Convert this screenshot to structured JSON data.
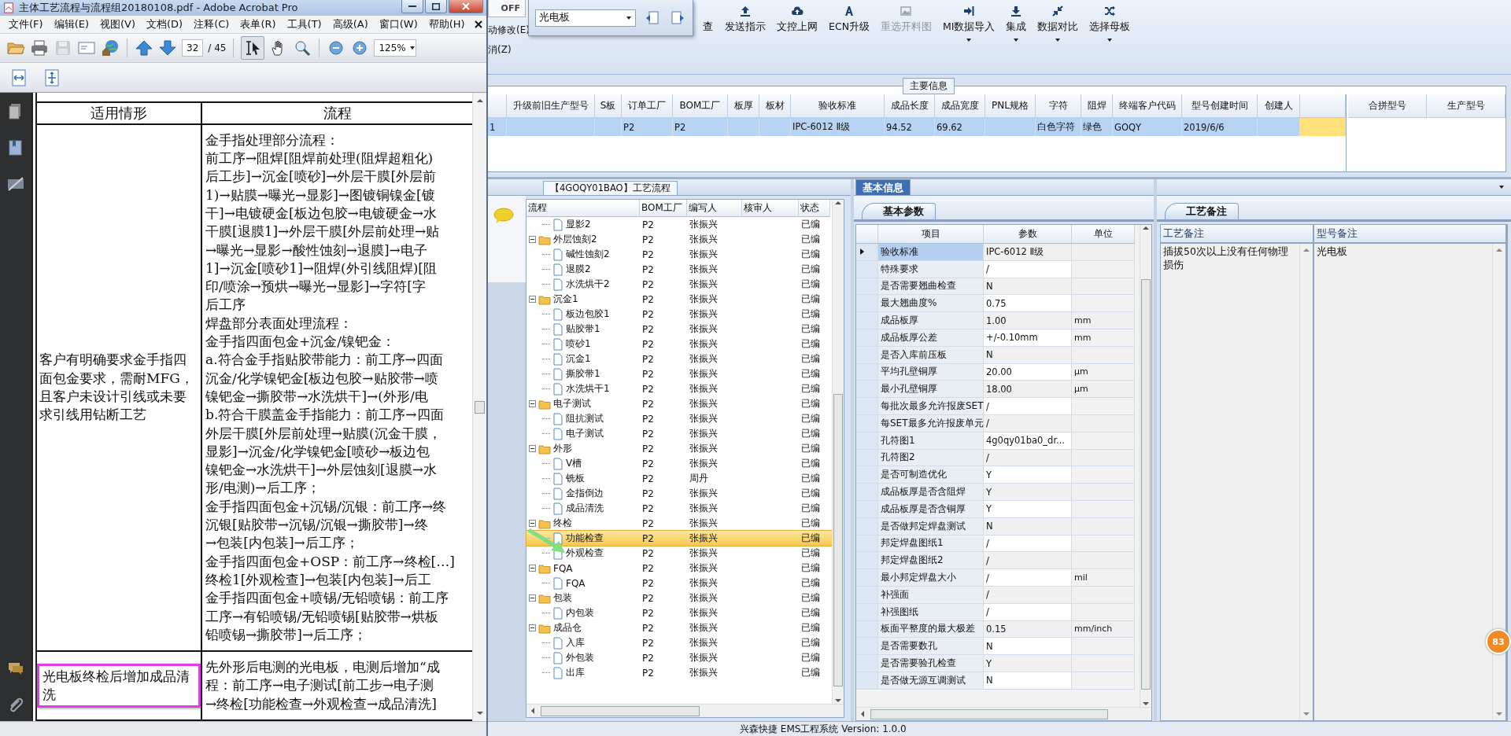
{
  "pdf_window": {
    "title": "主体工艺流程与流程组20180108.pdf - Adobe Acrobat Pro",
    "menu": [
      "文件(F)",
      "编辑(E)",
      "视图(V)",
      "文档(D)",
      "注释(C)",
      "表单(R)",
      "工具(T)",
      "高级(A)",
      "窗口(W)",
      "帮助(H)"
    ],
    "page": "32",
    "page_total": "/ 45",
    "zoom": "125%",
    "document": {
      "columns": [
        "适用情形",
        "流程"
      ],
      "rows": [
        {
          "situation": "客户有明确要求金手指四面包金要求，需耐MFG，且客户未设计引线或未要求引线用钻断工艺",
          "highlighted": false,
          "flow_lines": [
            "金手指处理部分流程：",
            "前工序→阻焊[阻焊前处理(阻焊超粗化)",
            "后工步]→沉金[喷砂]→外层干膜[外层前",
            "1)→贴膜→曝光→显影]→图镀铜镍金[镀",
            "干]→电镀硬金[板边包胶→电镀硬金→水",
            "干膜[退膜1]→外层干膜[外层前处理→贴",
            "→曝光→显影→酸性蚀刻→退膜]→电子",
            "1]→沉金[喷砂1]→阻焊(外引线阻焊)[阻",
            "印/喷涂→预烘→曝光→显影]→字符[字",
            "后工序",
            "焊盘部分表面处理流程：",
            "金手指四面包金+沉金/镍钯金：",
            "a.符合金手指贴胶带能力：前工序→四面",
            "沉金/化学镍钯金[板边包胶→贴胶带→喷",
            "镍钯金→撕胶带→水洗烘干]→(外形/电",
            "b.符合干膜盖金手指能力：前工序→四面",
            "外层干膜[外层前处理→贴膜(沉金干膜，",
            "显影]→沉金/化学镍钯金[喷砂→板边包",
            "镍钯金→水洗烘干]→外层蚀刻[退膜→水",
            "形/电测)→后工序；",
            "金手指四面包金+沉锡/沉银：前工序→终",
            "沉银[贴胶带→沉锡/沉银→撕胶带]→终",
            "→包装[内包装]→后工序；",
            "金手指四面包金+OSP：前工序→终检[…]",
            "终检1[外观检查]→包装[内包装]→后工",
            "金手指四面包金+喷锡/无铅喷锡：前工序",
            "工序→有铅喷锡/无铅喷锡[贴胶带→烘板",
            "铅喷锡→撕胶带]→后工序；"
          ]
        },
        {
          "situation": "光电板终检后增加成品清洗",
          "highlighted": true,
          "flow_lines": [
            "先外形后电测的光电板，电测后增加“成",
            "程：前工序→电子测试[前工步→电子测",
            "→终检[功能检查→外观检查→成品清洗]"
          ]
        }
      ]
    }
  },
  "ribbon": {
    "tab": "OFF",
    "left_items": [
      "动修改(E)",
      "消(Z)"
    ],
    "find_tool": {
      "value": "光电板"
    },
    "buttons": [
      {
        "label": "查",
        "kind": "hidden",
        "disabled": false,
        "has_menu": false
      },
      {
        "label": "发送指示",
        "kind": "upload",
        "disabled": false,
        "has_menu": false
      },
      {
        "label": "文控上网",
        "kind": "cloud",
        "disabled": false,
        "has_menu": false
      },
      {
        "label": "ECN升级",
        "kind": "letter",
        "disabled": false,
        "has_menu": false
      },
      {
        "label": "重选开料图",
        "kind": "image",
        "disabled": true,
        "has_menu": false
      },
      {
        "label": "MI数据导入",
        "kind": "import",
        "disabled": false,
        "has_menu": true
      },
      {
        "label": "集成",
        "kind": "download",
        "disabled": false,
        "has_menu": true
      },
      {
        "label": "数据对比",
        "kind": "compress",
        "disabled": false,
        "has_menu": true
      },
      {
        "label": "选择母板",
        "kind": "shuffle",
        "disabled": false,
        "has_menu": true
      }
    ]
  },
  "main_info": {
    "title": "主要信息",
    "columns": [
      "升级前旧生产型号",
      "S板",
      "订单工厂",
      "BOM工厂",
      "板厚",
      "板材",
      "验收标准",
      "成品长度",
      "成品宽度",
      "PNL规格",
      "字符",
      "阻焊",
      "终端客户代码",
      "型号创建时间",
      "创建人"
    ],
    "rows": [
      {
        "number": "1",
        "selected": true,
        "cells": [
          null,
          null,
          "P2",
          "P2",
          null,
          null,
          "IPC-6012 Ⅱ级",
          "94.52",
          "69.62",
          null,
          "白色字符",
          "绿色",
          "GOQY",
          "2019/6/6",
          null
        ]
      }
    ],
    "merge_columns": [
      "合拼型号",
      "生产型号"
    ]
  },
  "process_panel": {
    "tab": "【4GOQY01BAO】工艺流程",
    "columns": [
      "流程",
      "BOM工厂",
      "编写人",
      "核审人",
      "状态"
    ],
    "nodes": [
      {
        "children": [
          {
            "name": "显影2",
            "bom": "P2",
            "writer": "张振兴",
            "status": "已编",
            "selected": false
          }
        ]
      },
      {
        "name": "外层蚀刻2",
        "bom": "P2",
        "writer": "张振兴",
        "status": "已编",
        "selected": false,
        "expanded": true,
        "children": [
          {
            "name": "碱性蚀刻2",
            "bom": "P2",
            "writer": "张振兴",
            "status": "已编",
            "selected": false
          },
          {
            "name": "退膜2",
            "bom": "P2",
            "writer": "张振兴",
            "status": "已编",
            "selected": false
          },
          {
            "name": "水洗烘干2",
            "bom": "P2",
            "writer": "张振兴",
            "status": "已编",
            "selected": false
          }
        ]
      },
      {
        "name": "沉金1",
        "bom": "P2",
        "writer": "张振兴",
        "status": "已编",
        "selected": false,
        "expanded": true,
        "children": [
          {
            "name": "板边包胶1",
            "bom": "P2",
            "writer": "张振兴",
            "status": "已编",
            "selected": false
          },
          {
            "name": "贴胶带1",
            "bom": "P2",
            "writer": "张振兴",
            "status": "已编",
            "selected": false
          },
          {
            "name": "喷砂1",
            "bom": "P2",
            "writer": "张振兴",
            "status": "已编",
            "selected": false
          },
          {
            "name": "沉金1",
            "bom": "P2",
            "writer": "张振兴",
            "status": "已编",
            "selected": false
          },
          {
            "name": "撕胶带1",
            "bom": "P2",
            "writer": "张振兴",
            "status": "已编",
            "selected": false
          },
          {
            "name": "水洗烘干1",
            "bom": "P2",
            "writer": "张振兴",
            "status": "已编",
            "selected": false
          }
        ]
      },
      {
        "name": "电子测试",
        "bom": "P2",
        "writer": "张振兴",
        "status": "已编",
        "selected": false,
        "expanded": true,
        "children": [
          {
            "name": "阻抗测试",
            "bom": "P2",
            "writer": "张振兴",
            "status": "已编",
            "selected": false
          },
          {
            "name": "电子测试",
            "bom": "P2",
            "writer": "张振兴",
            "status": "已编",
            "selected": false
          }
        ]
      },
      {
        "name": "外形",
        "bom": "P2",
        "writer": "张振兴",
        "status": "已编",
        "selected": false,
        "expanded": true,
        "children": [
          {
            "name": "V槽",
            "bom": "P2",
            "writer": "张振兴",
            "status": "已编",
            "selected": false
          },
          {
            "name": "铣板",
            "bom": "P2",
            "writer": "周丹",
            "status": "已编",
            "selected": false
          },
          {
            "name": "金指倒边",
            "bom": "P2",
            "writer": "张振兴",
            "status": "已编",
            "selected": false
          },
          {
            "name": "成品清洗",
            "bom": "P2",
            "writer": "张振兴",
            "status": "已编",
            "selected": false
          }
        ]
      },
      {
        "name": "终检",
        "bom": "P2",
        "writer": "张振兴",
        "status": "已编",
        "selected": false,
        "expanded": true,
        "children": [
          {
            "name": "功能检查",
            "bom": "P2",
            "writer": "张振兴",
            "status": "已编",
            "selected": true
          },
          {
            "name": "外观检查",
            "bom": "P2",
            "writer": "张振兴",
            "status": "已编",
            "selected": false
          }
        ]
      },
      {
        "name": "FQA",
        "bom": "P2",
        "writer": "张振兴",
        "status": "已编",
        "selected": false,
        "expanded": true,
        "children": [
          {
            "name": "FQA",
            "bom": "P2",
            "writer": "张振兴",
            "status": "已编",
            "selected": false
          }
        ]
      },
      {
        "name": "包装",
        "bom": "P2",
        "writer": "张振兴",
        "status": "已编",
        "selected": false,
        "expanded": true,
        "children": [
          {
            "name": "内包装",
            "bom": "P2",
            "writer": "张振兴",
            "status": "已编",
            "selected": false
          }
        ]
      },
      {
        "name": "成品仓",
        "bom": "P2",
        "writer": "张振兴",
        "status": "已编",
        "selected": false,
        "expanded": true,
        "children": [
          {
            "name": "入库",
            "bom": "P2",
            "writer": "张振兴",
            "status": "已编",
            "selected": false
          },
          {
            "name": "外包装",
            "bom": "P2",
            "writer": "张振兴",
            "status": "已编",
            "selected": false
          },
          {
            "name": "出库",
            "bom": "P2",
            "writer": "张振兴",
            "status": "已编",
            "selected": false
          }
        ]
      }
    ]
  },
  "basic_info": {
    "tab": "基本信息",
    "subtab": "基本参数",
    "columns": [
      "项目",
      "参数",
      "单位"
    ],
    "rows": [
      {
        "item": "验收标准",
        "value": "IPC-6012 Ⅱ级",
        "selected": true
      },
      {
        "item": "特殊要求",
        "value": "/",
        "selected": false
      },
      {
        "item": "是否需要翘曲检查",
        "value": "N",
        "selected": false
      },
      {
        "item": "最大翘曲度%",
        "value": "0.75",
        "selected": false
      },
      {
        "item": "成品板厚",
        "value": "1.00",
        "unit": "mm",
        "selected": false
      },
      {
        "item": "成品板厚公差",
        "value": "+/-0.10mm",
        "unit": "mm",
        "selected": false
      },
      {
        "item": "是否入库前压板",
        "value": "N",
        "selected": false
      },
      {
        "item": "平均孔壁铜厚",
        "value": "20.00",
        "unit": "μm",
        "selected": false
      },
      {
        "item": "最小孔壁铜厚",
        "value": "18.00",
        "unit": "μm",
        "selected": false
      },
      {
        "item": "每批次最多允许报废SET",
        "value": "/",
        "selected": false
      },
      {
        "item": "每SET最多允许报废单元",
        "value": "/",
        "selected": false
      },
      {
        "item": "孔符图1",
        "value": "4g0qy01ba0_dr...",
        "selected": false
      },
      {
        "item": "孔符图2",
        "value": "/",
        "selected": false
      },
      {
        "item": "是否可制造优化",
        "value": "Y",
        "selected": false
      },
      {
        "item": "成品板厚是否含阻焊",
        "value": "Y",
        "selected": false
      },
      {
        "item": "成品板厚是否含铜厚",
        "value": "Y",
        "selected": false
      },
      {
        "item": "是否做邦定焊盘测试",
        "value": "N",
        "selected": false
      },
      {
        "item": "邦定焊盘图纸1",
        "value": "/",
        "selected": false
      },
      {
        "item": "邦定焊盘图纸2",
        "value": "/",
        "selected": false
      },
      {
        "item": "最小邦定焊盘大小",
        "value": "/",
        "unit": "mil",
        "selected": false
      },
      {
        "item": "补强面",
        "value": "/",
        "selected": false
      },
      {
        "item": "补强图纸",
        "value": "/",
        "selected": false
      },
      {
        "item": "板面平整度的最大极差",
        "value": "0.15",
        "unit": "mm/inch",
        "selected": false
      },
      {
        "item": "是否需要数孔",
        "value": "N",
        "selected": false
      },
      {
        "item": "是否需要验孔检查",
        "value": "Y",
        "selected": false
      },
      {
        "item": "是否做无源互调测试",
        "value": "N",
        "selected": false
      }
    ]
  },
  "notes": {
    "tab": "工艺备注",
    "columns": [
      "工艺备注",
      "型号备注"
    ],
    "values": [
      "插拔50次以上没有任何物理损伤",
      "光电板"
    ]
  },
  "badge": "83",
  "status_bar": {
    "text": "兴森快捷 EMS工程系统 Version: 1.0.0"
  }
}
